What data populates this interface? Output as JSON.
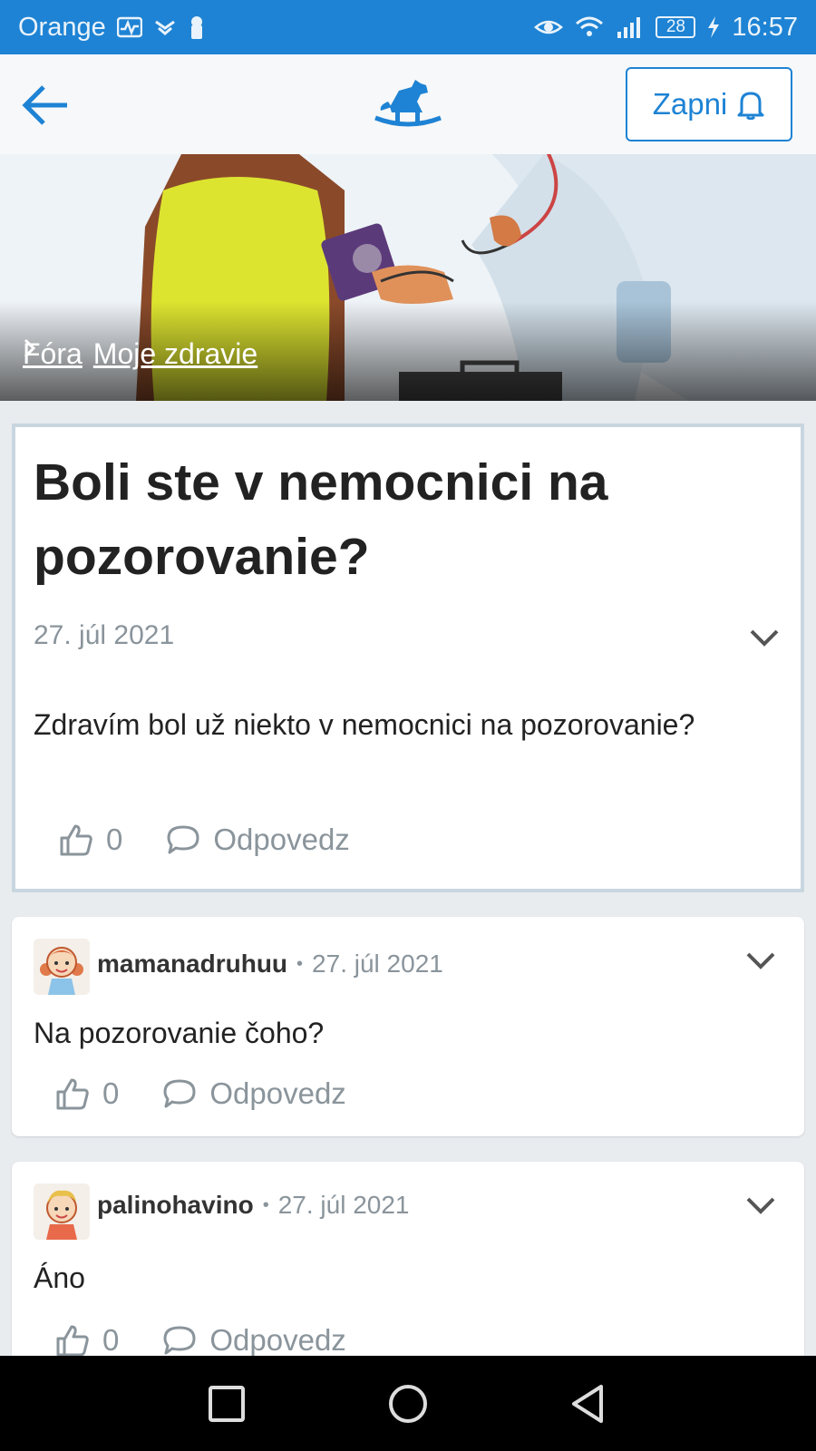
{
  "status_bar": {
    "carrier": "Orange",
    "battery": "28",
    "time": "16:57"
  },
  "app_bar": {
    "zapni_label": "Zapni"
  },
  "breadcrumb": {
    "root": "Fóra",
    "current": "Moje zdravie"
  },
  "post": {
    "title": "Boli ste v nemocnici na pozorovanie?",
    "date": "27. júl 2021",
    "body": "Zdravím bol už niekto v nemocnici na pozorovanie?",
    "likes": "0",
    "reply_label": "Odpovedz"
  },
  "comments": [
    {
      "user": "mamanadruhuu",
      "date": "27. júl 2021",
      "text": "Na pozorovanie čoho?",
      "likes": "0",
      "reply_label": "Odpovedz"
    },
    {
      "user": "palinohavino",
      "date": "27. júl 2021",
      "text": "Áno",
      "likes": "0",
      "reply_label": "Odpovedz"
    }
  ],
  "colors": {
    "accent": "#1e83d4",
    "muted": "#8a949b"
  }
}
